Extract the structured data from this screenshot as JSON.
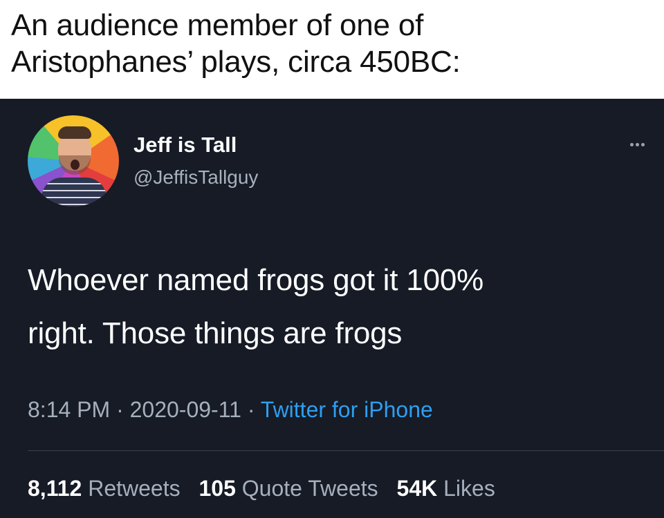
{
  "caption": {
    "line1": "An audience member of one of",
    "line2": "Aristophanes’ plays, circa 450BC:"
  },
  "tweet": {
    "display_name": "Jeff is Tall",
    "handle": "@JeffisTallguy",
    "text_line1": "Whoever named frogs got it 100%",
    "text_line2": "right. Those things are frogs",
    "time": "8:14 PM",
    "separator1": " · ",
    "date": "2020-09-11",
    "separator2": " · ",
    "source": "Twitter for iPhone",
    "retweets_count": "8,112",
    "retweets_label": "Retweets",
    "quote_count": "105",
    "quote_label": "Quote Tweets",
    "likes_count": "54K",
    "likes_label": "Likes"
  },
  "icons": {
    "more": "more-options-icon",
    "avatar": "profile-avatar"
  },
  "colors": {
    "tweet_background": "#161b26",
    "link_blue": "#2d9ff0",
    "secondary_text": "#a6b0bd",
    "caption_background": "#ffffff"
  }
}
